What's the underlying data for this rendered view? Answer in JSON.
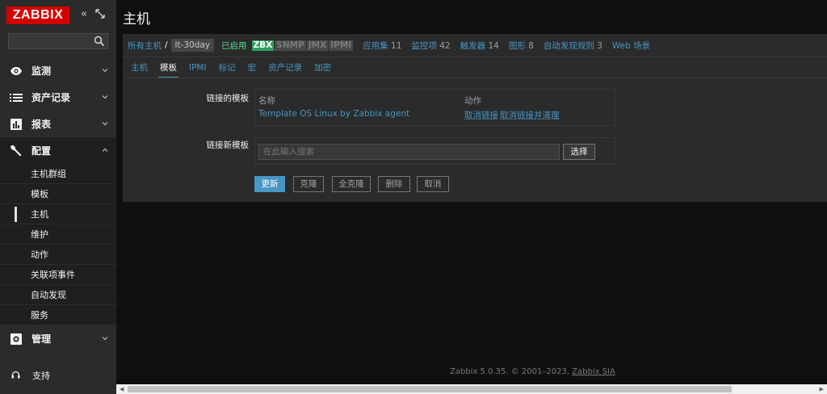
{
  "sidebar": {
    "logo": "ZABBIX",
    "collapse_icon": "«",
    "kiosk_icon": "⤢",
    "search_placeholder": "",
    "menu": [
      {
        "label": "监测",
        "icon": "eye-icon"
      },
      {
        "label": "资产记录",
        "icon": "list-icon"
      },
      {
        "label": "报表",
        "icon": "bar-chart-icon"
      },
      {
        "label": "配置",
        "icon": "wrench-icon",
        "open": true
      },
      {
        "label": "管理",
        "icon": "gear-icon"
      }
    ],
    "config_items": [
      "主机群组",
      "模板",
      "主机",
      "维护",
      "动作",
      "关联项事件",
      "自动发现",
      "服务"
    ],
    "active_item": "主机",
    "support_label": "支持"
  },
  "header": {
    "title": "主机"
  },
  "host_nav": {
    "all_hosts": "所有主机",
    "separator": "/",
    "host_name": "lt-30day",
    "status": "已启用",
    "availability": [
      "ZBX",
      "SNMP",
      "JMX",
      "IPMI"
    ],
    "links": [
      {
        "label": "应用集",
        "count": "11"
      },
      {
        "label": "监控项",
        "count": "42"
      },
      {
        "label": "触发器",
        "count": "14"
      },
      {
        "label": "图形",
        "count": "8"
      },
      {
        "label": "自动发现规则",
        "count": "3"
      },
      {
        "label": "Web 场景",
        "count": ""
      }
    ]
  },
  "tabs": [
    "主机",
    "模板",
    "IPMI",
    "标记",
    "宏",
    "资产记录",
    "加密"
  ],
  "active_tab": "模板",
  "form": {
    "linked_label": "链接的模板",
    "col_name": "名称",
    "col_action": "动作",
    "template_name": "Template OS Linux by Zabbix agent",
    "unlink": "取消链接",
    "unlink_clear": "取消链接并清理",
    "new_label": "链接新模板",
    "search_placeholder": "在此输入搜索",
    "select_button": "选择"
  },
  "buttons": {
    "update": "更新",
    "clone": "克隆",
    "full_clone": "全克隆",
    "delete": "删除",
    "cancel": "取消"
  },
  "footer": {
    "text": "Zabbix 5.0.35. © 2001–2023, ",
    "company": "Zabbix SIA"
  },
  "colors": {
    "brand": "#d40000",
    "link": "#4796c4",
    "enabled": "#59db8f",
    "zbx": "#2f9f5e",
    "panel": "#2b2b2b"
  }
}
